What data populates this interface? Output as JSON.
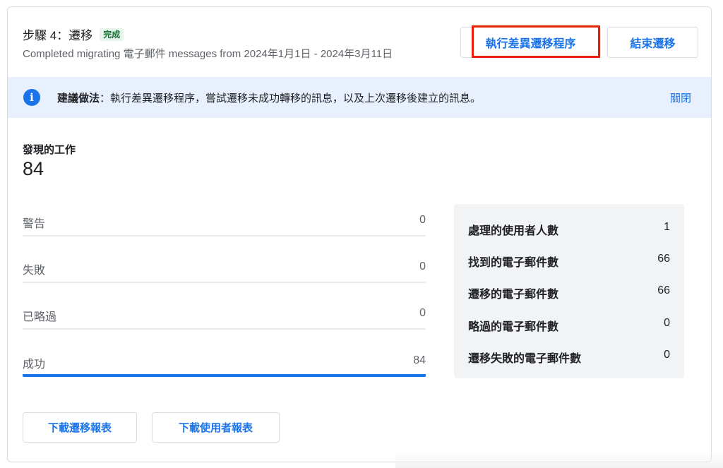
{
  "header": {
    "title": "步驟 4：遷移",
    "status_badge": "完成",
    "subtitle": "Completed migrating 電子郵件 messages from 2024年1月1日 - 2024年3月11日",
    "run_delta_button": "執行差異遷移程序",
    "end_migration_button": "結束遷移"
  },
  "banner": {
    "bold_prefix": "建議做法",
    "message": "：執行差異遷移程序，嘗試遷移未成功轉移的訊息，以及上次遷移後建立的訊息。",
    "close_label": "關閉",
    "icon": "info-icon"
  },
  "tasks": {
    "label": "發現的工作",
    "value": "84",
    "rows": [
      {
        "label": "警告",
        "value": "0"
      },
      {
        "label": "失敗",
        "value": "0"
      },
      {
        "label": "已略過",
        "value": "0"
      },
      {
        "label": "成功",
        "value": "84"
      }
    ]
  },
  "summary": {
    "rows": [
      {
        "label": "處理的使用者人數",
        "value": "1"
      },
      {
        "label": "找到的電子郵件數",
        "value": "66"
      },
      {
        "label": "遷移的電子郵件數",
        "value": "66"
      },
      {
        "label": "略過的電子郵件數",
        "value": "0"
      },
      {
        "label": "遷移失敗的電子郵件數",
        "value": "0"
      }
    ]
  },
  "footer": {
    "download_migration_report": "下載遷移報表",
    "download_user_report": "下載使用者報表"
  },
  "colors": {
    "accent": "#1a73e8",
    "success_badge_bg": "#e6f4ea",
    "success_badge_text": "#137333",
    "highlight_box": "#e8200a",
    "banner_bg": "#e8f0fe"
  }
}
